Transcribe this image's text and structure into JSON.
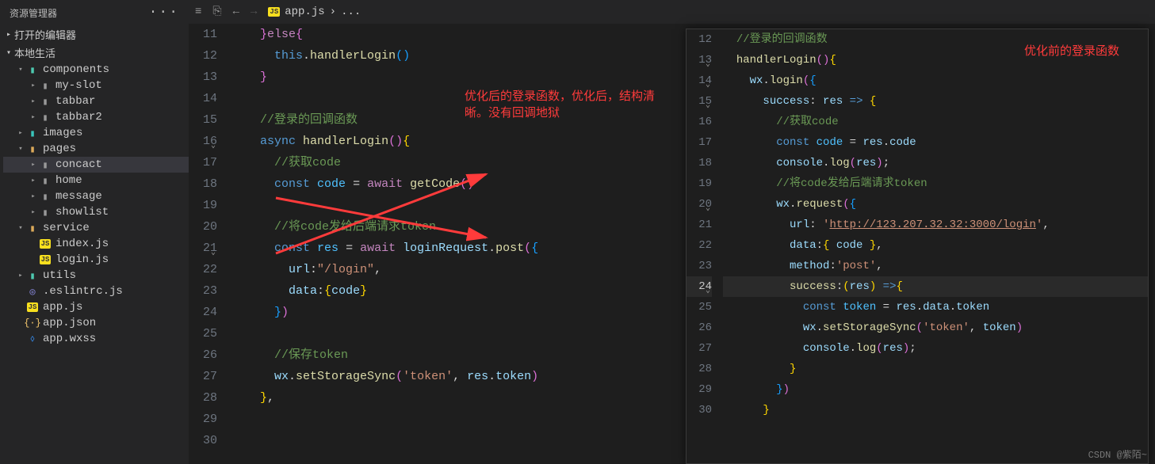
{
  "sidebar": {
    "title": "资源管理器",
    "sections": [
      {
        "label": "打开的编辑器",
        "expanded": false
      },
      {
        "label": "本地生活",
        "expanded": true
      }
    ],
    "tree": [
      {
        "type": "folder",
        "label": "components",
        "icon": "folder-green",
        "expanded": true,
        "indent": 1
      },
      {
        "type": "folder",
        "label": "my-slot",
        "icon": "folder-grey",
        "expanded": false,
        "indent": 2
      },
      {
        "type": "folder",
        "label": "tabbar",
        "icon": "folder-grey",
        "expanded": false,
        "indent": 2
      },
      {
        "type": "folder",
        "label": "tabbar2",
        "icon": "folder-grey",
        "expanded": false,
        "indent": 2
      },
      {
        "type": "folder",
        "label": "images",
        "icon": "folder-teal",
        "expanded": false,
        "indent": 1
      },
      {
        "type": "folder",
        "label": "pages",
        "icon": "folder-orange",
        "expanded": true,
        "indent": 1
      },
      {
        "type": "folder",
        "label": "concact",
        "icon": "folder-grey",
        "expanded": false,
        "indent": 2,
        "selected": true
      },
      {
        "type": "folder",
        "label": "home",
        "icon": "folder-grey",
        "expanded": false,
        "indent": 2
      },
      {
        "type": "folder",
        "label": "message",
        "icon": "folder-grey",
        "expanded": false,
        "indent": 2
      },
      {
        "type": "folder",
        "label": "showlist",
        "icon": "folder-grey",
        "expanded": false,
        "indent": 2
      },
      {
        "type": "folder",
        "label": "service",
        "icon": "folder-orange",
        "expanded": true,
        "indent": 1
      },
      {
        "type": "file",
        "label": "index.js",
        "icon": "js",
        "indent": 2
      },
      {
        "type": "file",
        "label": "login.js",
        "icon": "js",
        "indent": 2
      },
      {
        "type": "folder",
        "label": "utils",
        "icon": "folder-green",
        "expanded": false,
        "indent": 1
      },
      {
        "type": "file",
        "label": ".eslintrc.js",
        "icon": "eslint",
        "indent": 1
      },
      {
        "type": "file",
        "label": "app.js",
        "icon": "js",
        "indent": 1
      },
      {
        "type": "file",
        "label": "app.json",
        "icon": "json",
        "indent": 1
      },
      {
        "type": "file",
        "label": "app.wxss",
        "icon": "wxss",
        "indent": 1
      }
    ]
  },
  "breadcrumb": {
    "file": "app.js",
    "trail": "..."
  },
  "annotations": {
    "left": "优化后的登录函数，优化后，结构清晰。没有回调地狱",
    "right": "优化前的登录函数"
  },
  "left_editor": {
    "lines": [
      {
        "n": 11,
        "tokens": [
          [
            "    ",
            ""
          ],
          [
            "}",
            "brace2"
          ],
          [
            "else",
            "kw"
          ],
          [
            "{",
            "brace2"
          ]
        ]
      },
      {
        "n": 12,
        "tokens": [
          [
            "      ",
            ""
          ],
          [
            "this",
            "this"
          ],
          [
            ".",
            ""
          ],
          [
            "handlerLogin",
            "fn"
          ],
          [
            "()",
            "brace3"
          ]
        ]
      },
      {
        "n": 13,
        "tokens": [
          [
            "    ",
            ""
          ],
          [
            "}",
            "brace2"
          ]
        ]
      },
      {
        "n": 14,
        "tokens": []
      },
      {
        "n": 15,
        "tokens": [
          [
            "    ",
            ""
          ],
          [
            "//登录的回调函数",
            "cmt"
          ]
        ]
      },
      {
        "n": 16,
        "fold": true,
        "tokens": [
          [
            "    ",
            ""
          ],
          [
            "async",
            "this"
          ],
          [
            " ",
            ""
          ],
          [
            "handlerLogin",
            "fn"
          ],
          [
            "()",
            "brace2"
          ],
          [
            "{",
            "brace1"
          ]
        ]
      },
      {
        "n": 17,
        "tokens": [
          [
            "      ",
            ""
          ],
          [
            "//获取code",
            "cmt"
          ]
        ]
      },
      {
        "n": 18,
        "tokens": [
          [
            "      ",
            ""
          ],
          [
            "const",
            "this"
          ],
          [
            " ",
            ""
          ],
          [
            "code",
            "const"
          ],
          [
            " = ",
            ""
          ],
          [
            "await",
            "kw"
          ],
          [
            " ",
            ""
          ],
          [
            "getCode",
            "fn"
          ],
          [
            "()",
            "brace2"
          ]
        ]
      },
      {
        "n": 19,
        "tokens": []
      },
      {
        "n": 20,
        "tokens": [
          [
            "      ",
            ""
          ],
          [
            "//将code发给后端请求token",
            "cmt"
          ]
        ]
      },
      {
        "n": 21,
        "fold": true,
        "tokens": [
          [
            "      ",
            ""
          ],
          [
            "const",
            "this"
          ],
          [
            " ",
            ""
          ],
          [
            "res",
            "const"
          ],
          [
            " = ",
            ""
          ],
          [
            "await",
            "kw"
          ],
          [
            " ",
            ""
          ],
          [
            "loginRequest",
            "var"
          ],
          [
            ".",
            ""
          ],
          [
            "post",
            "fn"
          ],
          [
            "(",
            "brace2"
          ],
          [
            "{",
            "brace3"
          ]
        ]
      },
      {
        "n": 22,
        "tokens": [
          [
            "        ",
            ""
          ],
          [
            "url",
            "var"
          ],
          [
            ":",
            ""
          ],
          [
            "\"/login\"",
            "str"
          ],
          [
            ",",
            ""
          ]
        ]
      },
      {
        "n": 23,
        "tokens": [
          [
            "        ",
            ""
          ],
          [
            "data",
            "var"
          ],
          [
            ":",
            ""
          ],
          [
            "{",
            "brace1"
          ],
          [
            "code",
            "var"
          ],
          [
            "}",
            "brace1"
          ]
        ]
      },
      {
        "n": 24,
        "tokens": [
          [
            "      ",
            ""
          ],
          [
            "}",
            "brace3"
          ],
          [
            ")",
            "brace2"
          ]
        ]
      },
      {
        "n": 25,
        "tokens": []
      },
      {
        "n": 26,
        "tokens": [
          [
            "      ",
            ""
          ],
          [
            "//保存token",
            "cmt"
          ]
        ]
      },
      {
        "n": 27,
        "tokens": [
          [
            "      ",
            ""
          ],
          [
            "wx",
            "var"
          ],
          [
            ".",
            ""
          ],
          [
            "setStorageSync",
            "fn"
          ],
          [
            "(",
            "brace2"
          ],
          [
            "'token'",
            "str"
          ],
          [
            ", ",
            ""
          ],
          [
            "res",
            "var"
          ],
          [
            ".",
            ""
          ],
          [
            "token",
            "var"
          ],
          [
            ")",
            "brace2"
          ]
        ]
      },
      {
        "n": 28,
        "tokens": [
          [
            "    ",
            ""
          ],
          [
            "}",
            "brace1"
          ],
          [
            ",",
            ""
          ]
        ]
      },
      {
        "n": 29,
        "tokens": []
      },
      {
        "n": 30,
        "tokens": []
      }
    ]
  },
  "right_editor": {
    "lines": [
      {
        "n": 12,
        "tokens": [
          [
            "  ",
            ""
          ],
          [
            "//登录的回调函数",
            "cmt"
          ]
        ]
      },
      {
        "n": 13,
        "fold": true,
        "tokens": [
          [
            "  ",
            ""
          ],
          [
            "handlerLogin",
            "fn"
          ],
          [
            "()",
            "brace2"
          ],
          [
            "{",
            "brace1"
          ]
        ]
      },
      {
        "n": 14,
        "fold": true,
        "tokens": [
          [
            "    ",
            ""
          ],
          [
            "wx",
            "var"
          ],
          [
            ".",
            ""
          ],
          [
            "login",
            "fn"
          ],
          [
            "(",
            "brace2"
          ],
          [
            "{",
            "brace3"
          ]
        ]
      },
      {
        "n": 15,
        "fold": true,
        "tokens": [
          [
            "      ",
            ""
          ],
          [
            "success",
            "var"
          ],
          [
            ": ",
            ""
          ],
          [
            "res",
            "var"
          ],
          [
            " ",
            ""
          ],
          [
            "=>",
            "this"
          ],
          [
            " ",
            ""
          ],
          [
            "{",
            "brace1"
          ]
        ]
      },
      {
        "n": 16,
        "tokens": [
          [
            "        ",
            ""
          ],
          [
            "//获取code",
            "cmt"
          ]
        ]
      },
      {
        "n": 17,
        "tokens": [
          [
            "        ",
            ""
          ],
          [
            "const",
            "this"
          ],
          [
            " ",
            ""
          ],
          [
            "code",
            "const"
          ],
          [
            " = ",
            ""
          ],
          [
            "res",
            "var"
          ],
          [
            ".",
            ""
          ],
          [
            "code",
            "var"
          ]
        ]
      },
      {
        "n": 18,
        "tokens": [
          [
            "        ",
            ""
          ],
          [
            "console",
            "var"
          ],
          [
            ".",
            ""
          ],
          [
            "log",
            "fn"
          ],
          [
            "(",
            "brace2"
          ],
          [
            "res",
            "var"
          ],
          [
            ")",
            "brace2"
          ],
          [
            ";",
            ""
          ]
        ]
      },
      {
        "n": 19,
        "tokens": [
          [
            "        ",
            ""
          ],
          [
            "//将code发给后端请求token",
            "cmt"
          ]
        ]
      },
      {
        "n": 20,
        "fold": true,
        "tokens": [
          [
            "        ",
            ""
          ],
          [
            "wx",
            "var"
          ],
          [
            ".",
            ""
          ],
          [
            "request",
            "fn"
          ],
          [
            "(",
            "brace2"
          ],
          [
            "{",
            "brace3"
          ]
        ]
      },
      {
        "n": 21,
        "tokens": [
          [
            "          ",
            ""
          ],
          [
            "url",
            "var"
          ],
          [
            ": ",
            ""
          ],
          [
            "'",
            "str"
          ],
          [
            "http://123.207.32.32:3000/login",
            "url"
          ],
          [
            "'",
            "str"
          ],
          [
            ",",
            ""
          ]
        ]
      },
      {
        "n": 22,
        "tokens": [
          [
            "          ",
            ""
          ],
          [
            "data",
            "var"
          ],
          [
            ":",
            ""
          ],
          [
            "{",
            "brace1"
          ],
          [
            " ",
            ""
          ],
          [
            "code",
            "var"
          ],
          [
            " ",
            ""
          ],
          [
            "}",
            "brace1"
          ],
          [
            ",",
            ""
          ]
        ]
      },
      {
        "n": 23,
        "tokens": [
          [
            "          ",
            ""
          ],
          [
            "method",
            "var"
          ],
          [
            ":",
            ""
          ],
          [
            "'post'",
            "str"
          ],
          [
            ",",
            ""
          ]
        ]
      },
      {
        "n": 24,
        "fold": true,
        "hl": true,
        "tokens": [
          [
            "          ",
            ""
          ],
          [
            "success",
            "fn"
          ],
          [
            ":",
            ""
          ],
          [
            "(",
            "brace1"
          ],
          [
            "res",
            "var"
          ],
          [
            ")",
            "brace1"
          ],
          [
            " ",
            ""
          ],
          [
            "=>",
            "this"
          ],
          [
            "{",
            "brace1"
          ]
        ]
      },
      {
        "n": 25,
        "tokens": [
          [
            "            ",
            ""
          ],
          [
            "const",
            "this"
          ],
          [
            " ",
            ""
          ],
          [
            "token",
            "const"
          ],
          [
            " = ",
            ""
          ],
          [
            "res",
            "var"
          ],
          [
            ".",
            ""
          ],
          [
            "data",
            "var"
          ],
          [
            ".",
            ""
          ],
          [
            "token",
            "var"
          ]
        ]
      },
      {
        "n": 26,
        "tokens": [
          [
            "            ",
            ""
          ],
          [
            "wx",
            "var"
          ],
          [
            ".",
            ""
          ],
          [
            "setStorageSync",
            "fn"
          ],
          [
            "(",
            "brace2"
          ],
          [
            "'token'",
            "str"
          ],
          [
            ", ",
            ""
          ],
          [
            "token",
            "var"
          ],
          [
            ")",
            "brace2"
          ]
        ]
      },
      {
        "n": 27,
        "tokens": [
          [
            "            ",
            ""
          ],
          [
            "console",
            "var"
          ],
          [
            ".",
            ""
          ],
          [
            "log",
            "fn"
          ],
          [
            "(",
            "brace2"
          ],
          [
            "res",
            "var"
          ],
          [
            ")",
            "brace2"
          ],
          [
            ";",
            ""
          ]
        ]
      },
      {
        "n": 28,
        "tokens": [
          [
            "          ",
            ""
          ],
          [
            "}",
            "brace1"
          ]
        ]
      },
      {
        "n": 29,
        "tokens": [
          [
            "        ",
            ""
          ],
          [
            "}",
            "brace3"
          ],
          [
            ")",
            "brace2"
          ]
        ]
      },
      {
        "n": 30,
        "tokens": [
          [
            "      ",
            ""
          ],
          [
            "}",
            "brace1"
          ]
        ]
      }
    ]
  },
  "watermark": "CSDN @紫陌~"
}
